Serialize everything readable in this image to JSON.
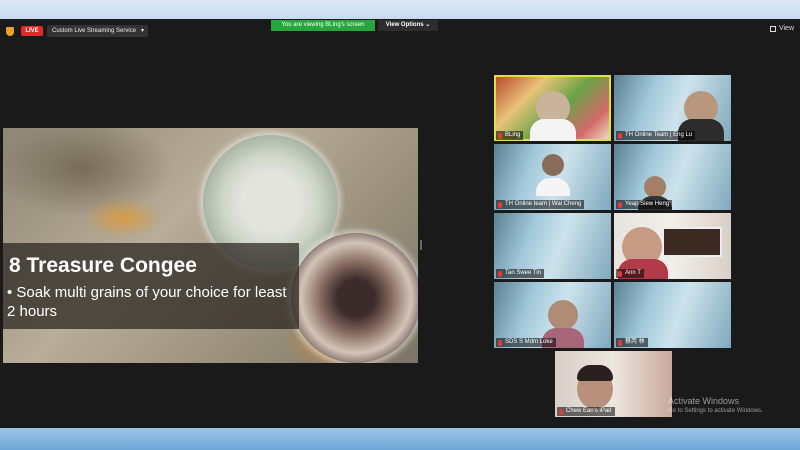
{
  "toolbar": {
    "live_label": "LIVE",
    "stream_service": "Custom Live Streaming Service",
    "share_banner": "You are viewing BLing's screen",
    "view_options": "View Options ⌄",
    "view_label": "View"
  },
  "shared_screen": {
    "title": "8 Treasure Congee",
    "bullet": "• Soak multi grains of your choice for least 2 hours"
  },
  "participants": [
    {
      "name": "BLing",
      "active": true
    },
    {
      "name": "TH Online Team | Eng Lu"
    },
    {
      "name": "TH Online team | Wai Cheng"
    },
    {
      "name": "Yeap Siew Heng"
    },
    {
      "name": "Tan Swee Tin"
    },
    {
      "name": "Ann T"
    },
    {
      "name": "SDS S Mdm Loke"
    },
    {
      "name": "蔡芮 林"
    },
    {
      "name": "Chew Ean's iPad"
    }
  ],
  "windows_watermark": {
    "line1": "Activate Windows",
    "line2": "Go to Settings to activate Windows."
  },
  "colors": {
    "live_red": "#e02828",
    "share_green": "#26a63c",
    "active_tile_border": "#d8e24a"
  }
}
